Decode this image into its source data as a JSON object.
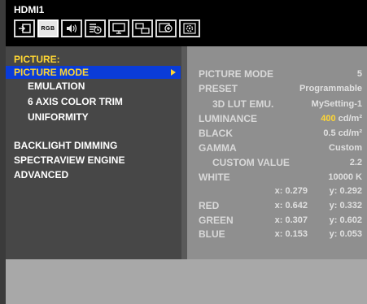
{
  "header": {
    "input_name": "HDMI1",
    "tabs": [
      {
        "icon": "input-icon"
      },
      {
        "icon": "picture-icon",
        "label": "RGB"
      },
      {
        "icon": "audio-icon"
      },
      {
        "icon": "schedule-icon"
      },
      {
        "icon": "monitor-icon"
      },
      {
        "icon": "multi-picture-icon"
      },
      {
        "icon": "protect-icon"
      },
      {
        "icon": "system-icon"
      }
    ],
    "active_tab": 1
  },
  "menu": {
    "section_title": "PICTURE:",
    "items": [
      {
        "label": "PICTURE MODE",
        "selected": true
      },
      {
        "label": "EMULATION"
      },
      {
        "label": "6 AXIS COLOR TRIM"
      },
      {
        "label": "UNIFORMITY"
      },
      {
        "label": "BACKLIGHT DIMMING"
      },
      {
        "label": "SPECTRAVIEW ENGINE"
      },
      {
        "label": "ADVANCED"
      }
    ]
  },
  "details": {
    "picture_mode": {
      "label": "PICTURE MODE",
      "value": "5"
    },
    "preset": {
      "label": "PRESET",
      "value": "Programmable"
    },
    "lut_emu": {
      "label": "3D LUT EMU.",
      "value": "MySetting-1"
    },
    "luminance": {
      "label": "LUMINANCE",
      "value_num": "400",
      "value_unit": "cd/m²"
    },
    "black": {
      "label": "BLACK",
      "value": "0.5 cd/m²"
    },
    "gamma": {
      "label": "GAMMA",
      "value": "Custom"
    },
    "custom_value": {
      "label": "CUSTOM VALUE",
      "value": "2.2"
    },
    "white": {
      "label": "WHITE",
      "value": "10000 K",
      "x": "x: 0.279",
      "y": "y: 0.292"
    },
    "red": {
      "label": "RED",
      "x": "x: 0.642",
      "y": "y: 0.332"
    },
    "green": {
      "label": "GREEN",
      "x": "x: 0.307",
      "y": "y: 0.602"
    },
    "blue": {
      "label": "BLUE",
      "x": "x: 0.153",
      "y": "y: 0.053"
    }
  },
  "colors": {
    "accent_yellow": "#ffd633",
    "selection_blue": "#0a3cd8"
  }
}
